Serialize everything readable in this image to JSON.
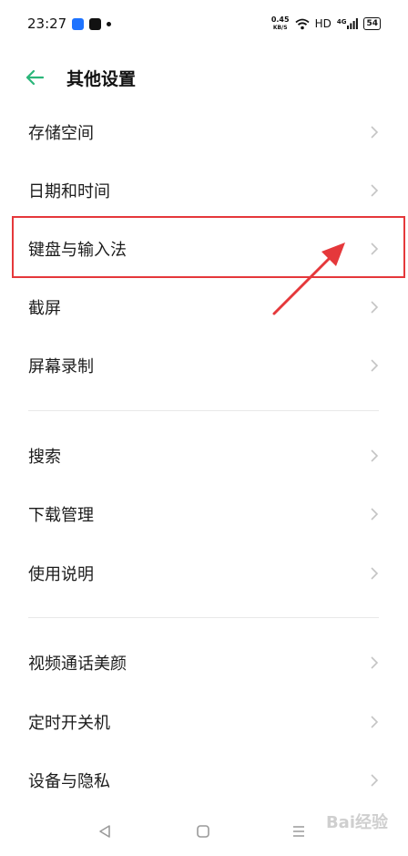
{
  "status_bar": {
    "time": "23:27",
    "net_speed_value": "0.45",
    "net_speed_unit": "KB/S",
    "hd_label": "HD",
    "signal_label": "4G",
    "battery": "54"
  },
  "header": {
    "title": "其他设置"
  },
  "groups": [
    [
      "存储空间",
      "日期和时间",
      "键盘与输入法",
      "截屏",
      "屏幕录制"
    ],
    [
      "搜索",
      "下载管理",
      "使用说明"
    ],
    [
      "视频通话美颜",
      "定时开关机",
      "设备与隐私"
    ]
  ],
  "items": {
    "storage": "存储空间",
    "datetime": "日期和时间",
    "keyboard": "键盘与输入法",
    "screenshot": "截屏",
    "screen_record": "屏幕录制",
    "search": "搜索",
    "download": "下载管理",
    "manual": "使用说明",
    "video_beauty": "视频通话美颜",
    "schedule_power": "定时开关机",
    "device_privacy": "设备与隐私"
  },
  "colors": {
    "accent": "#2bb67a",
    "highlight": "#e5383b",
    "chevron": "#c4c4c4",
    "divider": "#e8e8e8"
  },
  "watermark": "Bai经验"
}
